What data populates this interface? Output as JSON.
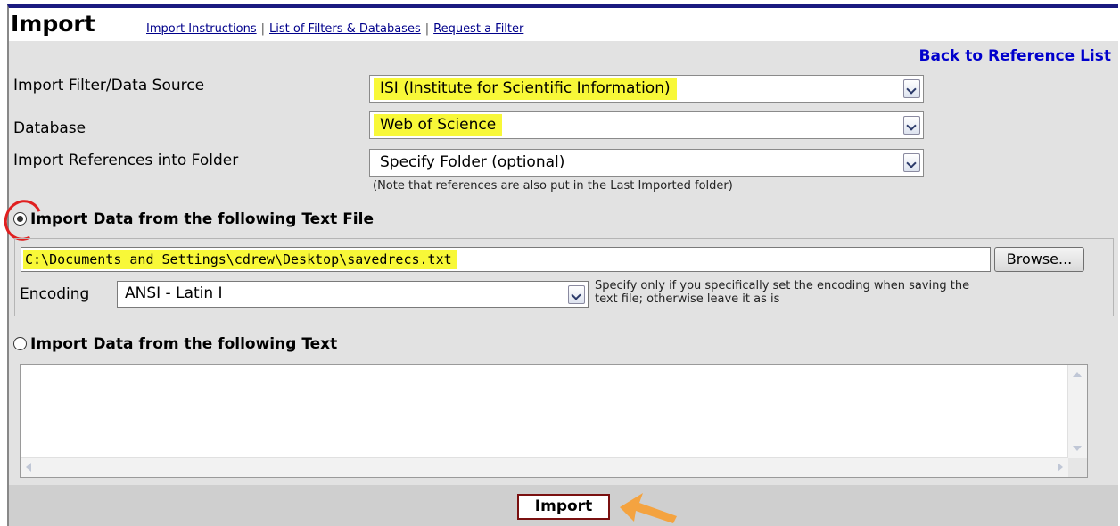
{
  "header": {
    "title": "Import",
    "links": [
      "Import Instructions",
      "List of Filters & Databases",
      "Request a Filter"
    ],
    "separator": "|"
  },
  "back_link": "Back to Reference List",
  "fields": {
    "filter": {
      "label": "Import Filter/Data Source",
      "value": "ISI (Institute for Scientific Information)"
    },
    "database": {
      "label": "Database",
      "value": "Web of Science"
    },
    "folder": {
      "label": "Import References into Folder",
      "value": "Specify Folder (optional)"
    },
    "folder_note": "(Note that references are also put in the Last Imported folder)"
  },
  "file_import": {
    "radio_label": "Import Data from the following Text File",
    "checked": true,
    "file_path": "C:\\Documents and Settings\\cdrew\\Desktop\\savedrecs.txt",
    "browse_label": "Browse...",
    "encoding_label": "Encoding",
    "encoding_value": "ANSI - Latin I",
    "encoding_note_line1": "Specify only if you specifically set the encoding when saving the",
    "encoding_note_line2": "text file; otherwise leave it as is"
  },
  "text_import": {
    "radio_label": "Import Data from the following Text",
    "checked": false,
    "value": ""
  },
  "footer": {
    "import_label": "Import"
  },
  "colors": {
    "highlight": "#f8f838",
    "annotation_circle": "#e02020",
    "annotation_arrow": "#f4a340",
    "panel_bg": "#e2e2e2",
    "link": "#0000cc"
  },
  "icons": [
    "dropdown-arrow-icon",
    "radio-icon",
    "scroll-up-icon",
    "scroll-down-icon",
    "scroll-left-icon",
    "scroll-right-icon",
    "pointer-arrow-icon"
  ]
}
